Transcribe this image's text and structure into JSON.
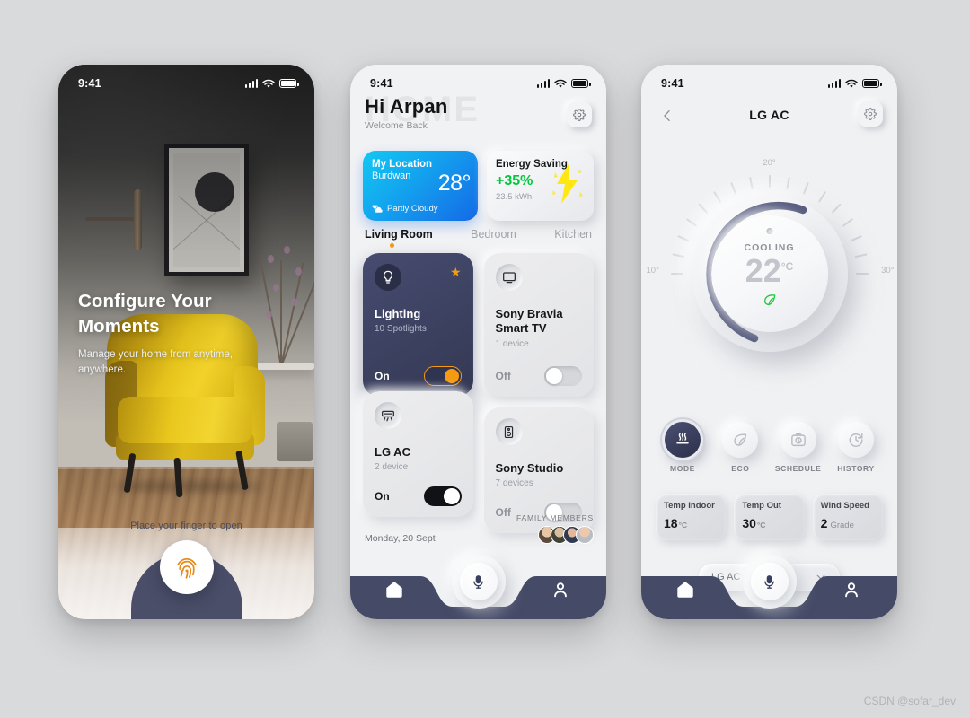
{
  "statusbar": {
    "time": "9:41"
  },
  "phone1": {
    "hero_title_line1": "Configure Your",
    "hero_title_line2": "Moments",
    "hero_subtitle": "Manage your home from anytime, anywhere.",
    "unlock_hint": "Place your finger to open",
    "fingerprint_icon": "fingerprint-icon",
    "accent_color": "#e88a17"
  },
  "phone2": {
    "watermark": "HOME",
    "greeting": "Hi  Arpan",
    "welcome": "Welcome Back",
    "gear_icon": "gear-icon",
    "location_card": {
      "title": "My Location",
      "city": "Burdwan",
      "temperature": "28°",
      "condition": "Partly Cloudy",
      "condition_icon": "partly-cloudy-icon",
      "gradient_from": "#12c8f2",
      "gradient_to": "#1569e6"
    },
    "energy_card": {
      "title": "Energy Saving",
      "percent": "+35%",
      "percent_color": "#00c73c",
      "usage": "23.5 kWh",
      "icon": "lightning-bolt-icon"
    },
    "tabs": [
      {
        "label": "Living Room",
        "active": true
      },
      {
        "label": "Bedroom",
        "active": false
      },
      {
        "label": "Kitchen",
        "active": false
      }
    ],
    "tab_dot_color": "#f59a12",
    "devices": [
      {
        "name": "Lighting",
        "sub": "10 Spotlights",
        "state": "On",
        "icon": "lightbulb-icon",
        "favorite": true
      },
      {
        "name_line1": "Sony Bravia",
        "name_line2": "Smart TV",
        "sub": "1 device",
        "state": "Off",
        "icon": "tv-icon"
      },
      {
        "name": "LG AC",
        "sub": "2 device",
        "state": "On",
        "icon": "air-conditioner-icon"
      },
      {
        "name": "Sony Studio",
        "sub": "7 devices",
        "state": "Off",
        "icon": "speaker-icon"
      }
    ],
    "date": "Monday, 20 Sept",
    "family_label": "FAMILY MEMBERS",
    "family_count": 4,
    "nav": [
      {
        "name": "home-icon",
        "label": "Home"
      },
      {
        "name": "microphone-icon",
        "label": "Voice"
      },
      {
        "name": "profile-icon",
        "label": "Profile"
      }
    ]
  },
  "phone3": {
    "title": "LG AC",
    "back_icon": "chevron-left-icon",
    "gear_icon": "gear-icon",
    "dial": {
      "label_min": "10°",
      "label_mid": "20°",
      "label_max": "30°",
      "mode_text": "COOLING",
      "temperature": "22",
      "unit": "°C",
      "eco_icon": "leaf-icon",
      "eco_color": "#1ec93c",
      "arc_color": "#585d80"
    },
    "modes": [
      {
        "label": "MODE",
        "icon": "heat-waves-icon",
        "active": true
      },
      {
        "label": "ECO",
        "icon": "leaf-icon",
        "active": false
      },
      {
        "label": "SCHEDULE",
        "icon": "schedule-camera-icon",
        "active": false
      },
      {
        "label": "HISTORY",
        "icon": "history-clock-icon",
        "active": false
      }
    ],
    "stats": [
      {
        "key": "Temp Indoor",
        "value": "18",
        "unit": "°C"
      },
      {
        "key": "Temp Out",
        "value": "30",
        "unit": "°C"
      },
      {
        "key": "Wind Speed",
        "value": "2",
        "unit": "Grade"
      }
    ],
    "device_select": {
      "value": "LG AC - LR",
      "chevron_icon": "chevron-down-icon"
    },
    "nav": [
      {
        "name": "home-icon",
        "label": "Home"
      },
      {
        "name": "microphone-icon",
        "label": "Voice"
      },
      {
        "name": "profile-icon",
        "label": "Profile"
      }
    ]
  },
  "watermark_credit": "CSDN @sofar_dev"
}
